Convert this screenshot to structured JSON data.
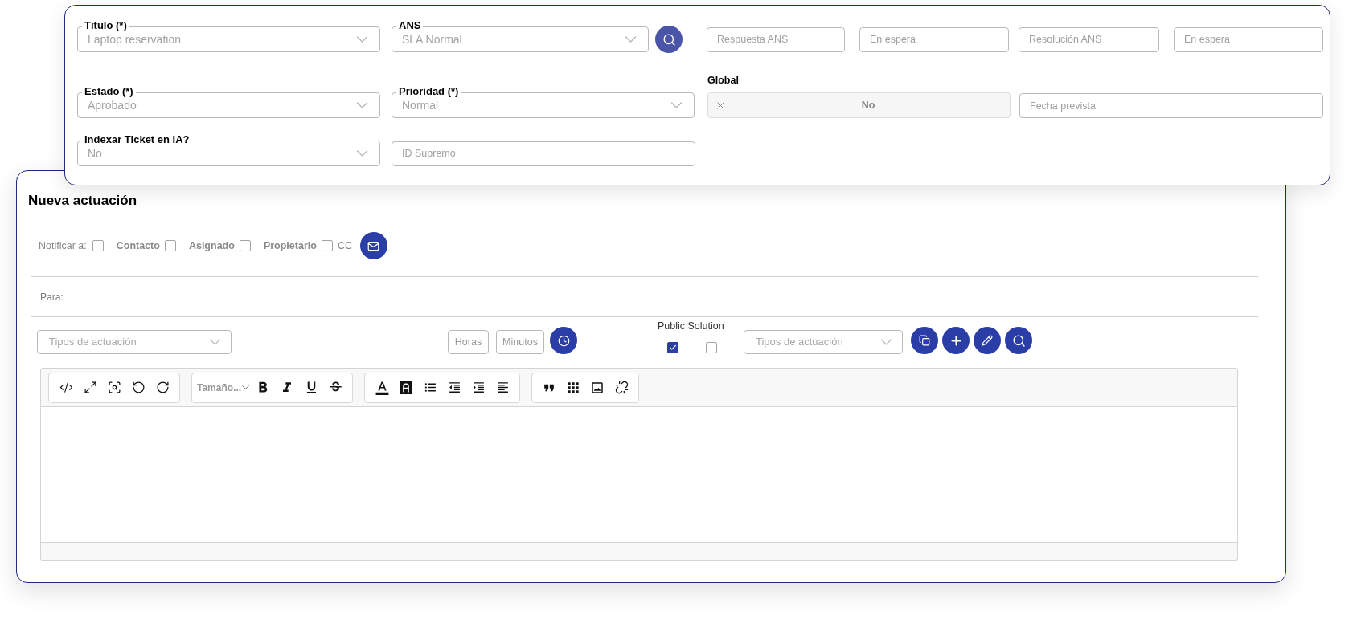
{
  "ticket_form": {
    "titulo": {
      "label": "Título (*)",
      "value": "Laptop reservation"
    },
    "ans": {
      "label": "ANS",
      "value": "SLA Normal"
    },
    "sla_fields": [
      {
        "placeholder": "Respuesta ANS"
      },
      {
        "placeholder": "En espera"
      },
      {
        "placeholder": "Resolución ANS"
      },
      {
        "placeholder": "En espera"
      }
    ],
    "estado": {
      "label": "Estado (*)",
      "value": "Aprobado"
    },
    "prioridad": {
      "label": "Prioridad (*)",
      "value": "Normal"
    },
    "global": {
      "label": "Global",
      "value": "No"
    },
    "fecha_prevista": {
      "placeholder": "Fecha prevista"
    },
    "indexar": {
      "label": "Indexar Ticket en IA?",
      "value": "No"
    },
    "id_supremo": {
      "placeholder": "ID Supremo"
    }
  },
  "nueva_actuacion": {
    "title": "Nueva actuación",
    "notify": [
      {
        "kind": "lead",
        "label": "Notificar a:",
        "checked": false
      },
      {
        "kind": "option",
        "label": "Contacto",
        "checked": false
      },
      {
        "kind": "option",
        "label": "Asignado",
        "checked": false
      },
      {
        "kind": "option",
        "label": "Propietario",
        "checked": false
      },
      {
        "kind": "text",
        "label": "CC"
      }
    ],
    "para": {
      "label": "Para:"
    },
    "tipo_actuacion": {
      "placeholder": "Tipos de actuación"
    },
    "horas": {
      "placeholder": "Horas"
    },
    "minutos": {
      "placeholder": "Minutos"
    },
    "public_solution": {
      "label": "Public Solution",
      "options": [
        {
          "checked": true
        },
        {
          "checked": false
        }
      ]
    },
    "tipo_actuacion_2": {
      "placeholder": "Tipos de actuación"
    },
    "editor": {
      "font_size": {
        "label": "Tamaño..."
      }
    }
  }
}
